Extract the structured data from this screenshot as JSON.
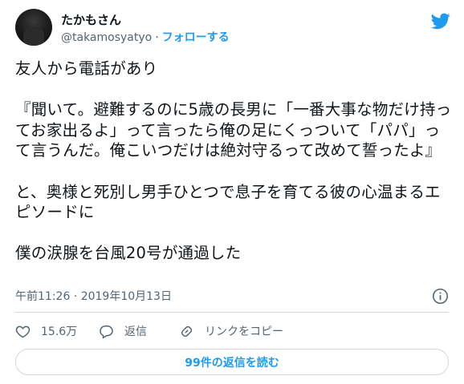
{
  "author": {
    "display_name": "たかもさん",
    "handle": "@takamosyatyo",
    "separator": "·",
    "follow_label": "フォローする"
  },
  "tweet": {
    "text": "友人から電話があり\n\n『聞いて。避難するのに5歳の長男に「一番大事な物だけ持ってお家出るよ」って言ったら俺の足にくっついて「パパ」って言うんだ。俺こいつだけは絶対守るって改めて誓ったよ』\n\nと、奥様と死別し男手ひとつで息子を育てる彼の心温まるエピソードに\n\n僕の涙腺を台風20号が通過した",
    "timestamp": "午前11:26 · 2019年10月13日"
  },
  "actions": {
    "like_count": "15.6万",
    "reply_label": "返信",
    "copy_link_label": "リンクをコピー"
  },
  "replies_button": {
    "label": "99件の返信を読む"
  },
  "icons": {
    "brand": "twitter-bird-icon",
    "info": "info-icon",
    "like": "heart-icon",
    "reply": "speech-bubble-icon",
    "copy": "link-icon"
  },
  "colors": {
    "accent": "#1d9bf0",
    "text": "#0f1419",
    "muted": "#536471",
    "border": "#cfd9de"
  }
}
